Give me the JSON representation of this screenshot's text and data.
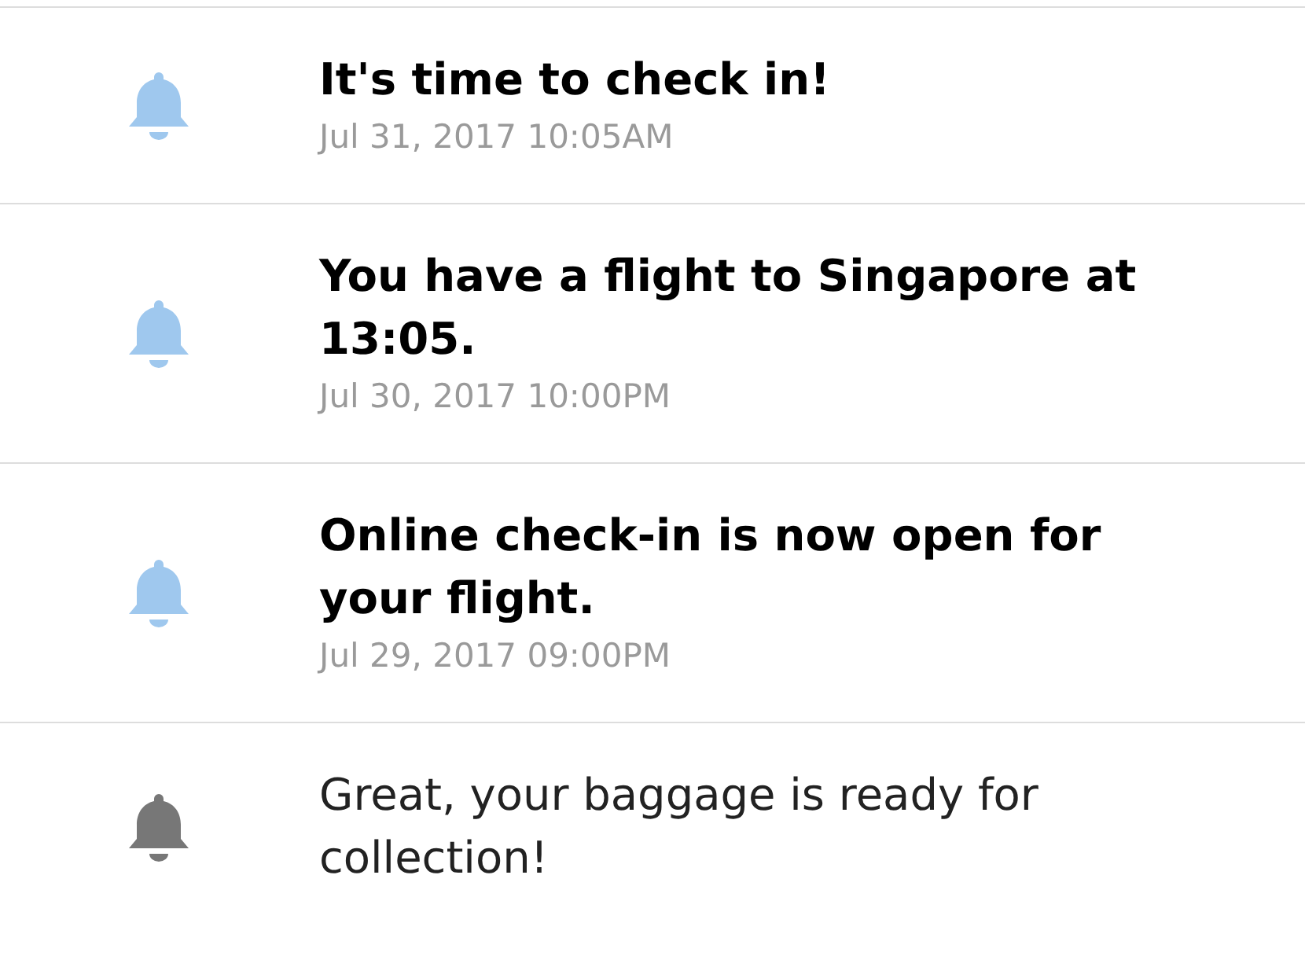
{
  "notifications": [
    {
      "title": "It's time to check in!",
      "time": "Jul 31, 2017 10:05AM",
      "unread": true
    },
    {
      "title": "You have a flight to Singapore at 13:05.",
      "time": "Jul 30, 2017 10:00PM",
      "unread": true
    },
    {
      "title": "Online check-in is now open for your flight.",
      "time": "Jul 29, 2017 09:00PM",
      "unread": true
    },
    {
      "title": "Great, your baggage is ready for collection!",
      "unread": false
    }
  ]
}
